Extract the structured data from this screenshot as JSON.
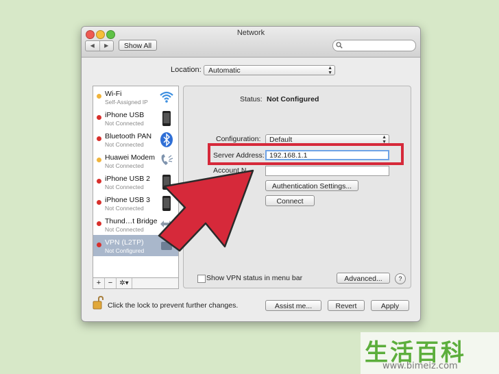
{
  "window": {
    "title": "Network",
    "show_all_label": "Show All",
    "nav_back": "◀",
    "nav_forward": "▶",
    "search_placeholder": ""
  },
  "location": {
    "label": "Location:",
    "value": "Automatic"
  },
  "services": [
    {
      "name": "Wi-Fi",
      "status": "Self-Assigned IP",
      "dot_color": "#f0b43c",
      "icon": "wifi-icon"
    },
    {
      "name": "iPhone USB",
      "status": "Not Connected",
      "dot_color": "#d8302c",
      "icon": "iphone-icon"
    },
    {
      "name": "Bluetooth PAN",
      "status": "Not Connected",
      "dot_color": "#d8302c",
      "icon": "bluetooth-icon"
    },
    {
      "name": "Huawei Modem",
      "status": "Not Connected",
      "dot_color": "#f0b43c",
      "icon": "phone-modem-icon"
    },
    {
      "name": "iPhone USB 2",
      "status": "Not Connected",
      "dot_color": "#d8302c",
      "icon": "iphone-icon"
    },
    {
      "name": "iPhone USB 3",
      "status": "Not Connected",
      "dot_color": "#d8302c",
      "icon": "iphone-icon"
    },
    {
      "name": "Thund…t Bridge",
      "status": "Not Connected",
      "dot_color": "#d8302c",
      "icon": "thunderbolt-bridge-icon"
    },
    {
      "name": "VPN (L2TP)",
      "status": "Not Configured",
      "dot_color": "#d8302c",
      "icon": "vpn-icon",
      "selected": true
    }
  ],
  "sidebar_footer": {
    "add": "+",
    "remove": "−",
    "action": "✲▾"
  },
  "detail": {
    "status_label": "Status:",
    "status_value": "Not Configured",
    "configuration_label": "Configuration:",
    "configuration_value": "Default",
    "server_address_label": "Server Address:",
    "server_address_value": "192.168.1.1",
    "account_name_label": "Account N",
    "account_name_value": "",
    "auth_settings_label": "Authentication Settings...",
    "connect_label": "Connect",
    "show_vpn_status_label": "Show VPN status in menu bar",
    "show_vpn_status_checked": false,
    "advanced_label": "Advanced...",
    "help_label": "?"
  },
  "footer": {
    "lock_text": "Click the lock to prevent further changes.",
    "assist_label": "Assist me...",
    "revert_label": "Revert",
    "apply_label": "Apply"
  },
  "annotation": {
    "highlight_color": "#d6293a",
    "arrow_color": "#d6293a"
  },
  "watermark": {
    "chars": "生活百科",
    "url": "www.bimeiz.com"
  }
}
